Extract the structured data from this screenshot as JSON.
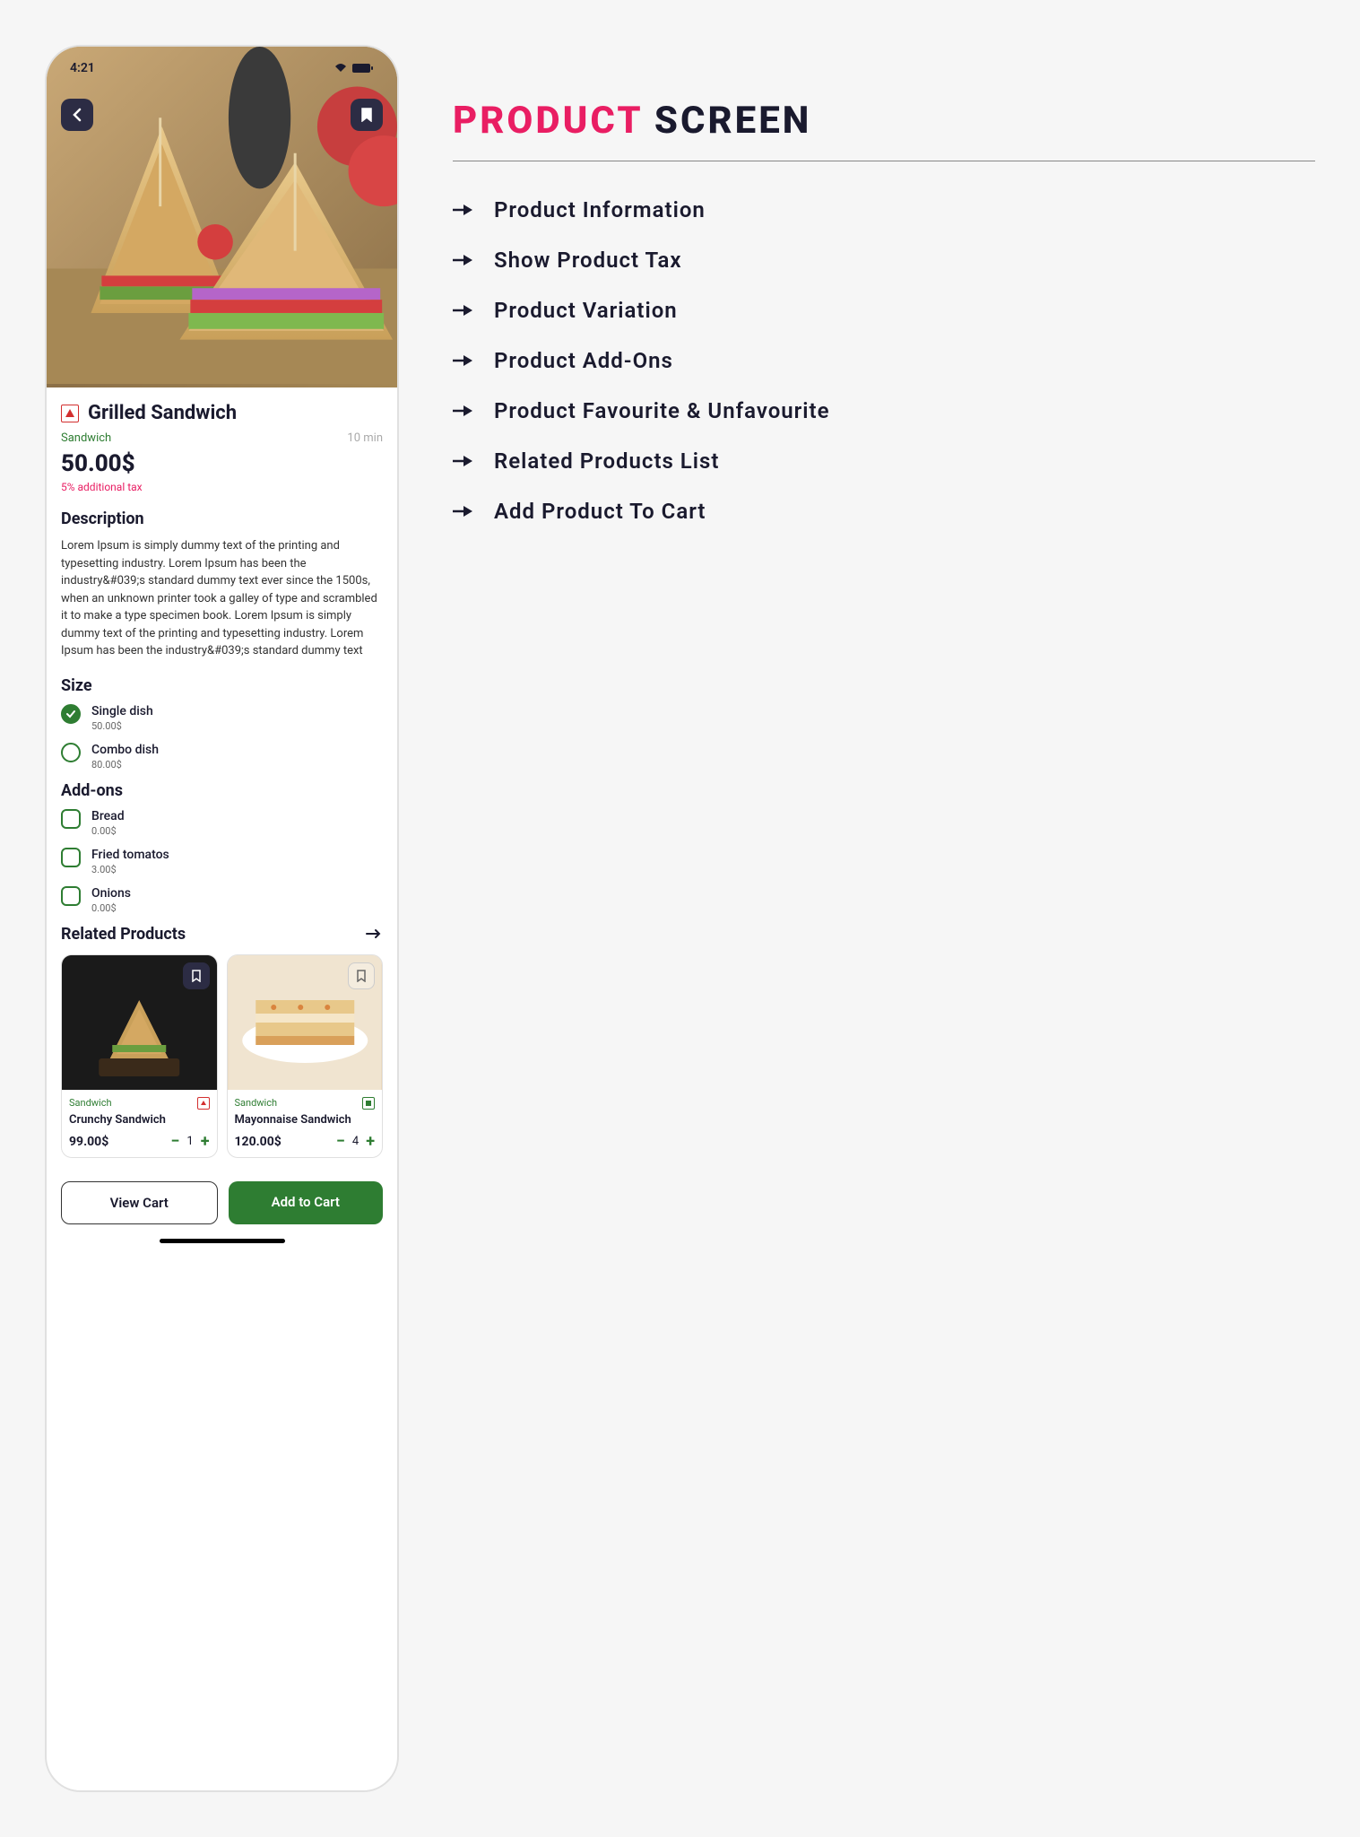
{
  "statusBar": {
    "time": "4:21"
  },
  "product": {
    "title": "Grilled Sandwich",
    "category": "Sandwich",
    "prepTime": "10 min",
    "price": "50.00$",
    "taxNote": "5% additional tax",
    "descriptionHeading": "Description",
    "description": "Lorem Ipsum is simply dummy text of the printing and typesetting industry. Lorem Ipsum has been the industry&#039;s standard dummy text ever since the 1500s, when an unknown printer took a galley of type and scrambled it to make a type specimen book. Lorem Ipsum is simply dummy text of the printing and typesetting industry. Lorem Ipsum has been the industry&#039;s standard dummy text"
  },
  "size": {
    "heading": "Size",
    "options": [
      {
        "label": "Single dish",
        "price": "50.00$",
        "selected": true
      },
      {
        "label": "Combo dish",
        "price": "80.00$",
        "selected": false
      }
    ]
  },
  "addons": {
    "heading": "Add-ons",
    "options": [
      {
        "label": "Bread",
        "price": "0.00$"
      },
      {
        "label": "Fried tomatos",
        "price": "3.00$"
      },
      {
        "label": "Onions",
        "price": "0.00$"
      }
    ]
  },
  "related": {
    "heading": "Related Products",
    "items": [
      {
        "category": "Sandwich",
        "title": "Crunchy Sandwich",
        "price": "99.00$",
        "qty": "1",
        "veg": false
      },
      {
        "category": "Sandwich",
        "title": "Mayonnaise Sandwich",
        "price": "120.00$",
        "qty": "4",
        "veg": true
      }
    ]
  },
  "actions": {
    "viewCart": "View Cart",
    "addToCart": "Add to Cart"
  },
  "features": {
    "titleAccent": "PRODUCT",
    "titleDark": "SCREEN",
    "items": [
      "Product Information",
      "Show Product Tax",
      "Product Variation",
      "Product Add-Ons",
      "Product Favourite & Unfavourite",
      "Related Products List",
      "Add Product To Cart"
    ]
  }
}
